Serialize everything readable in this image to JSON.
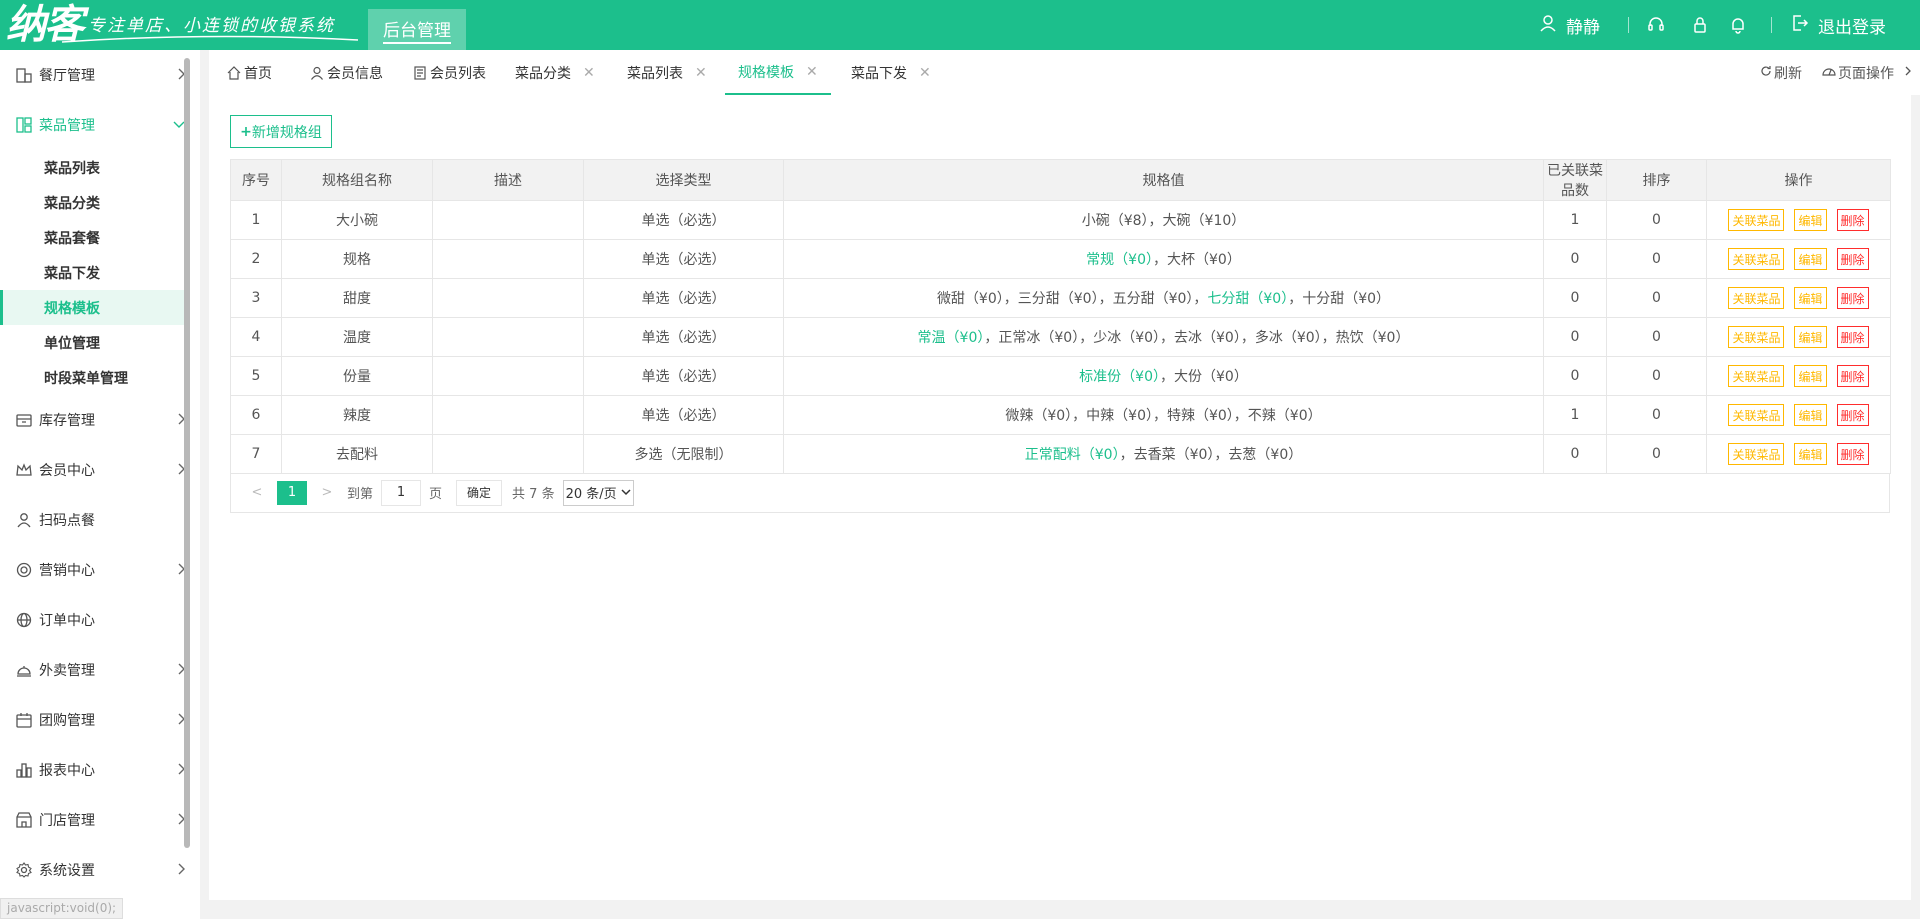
{
  "header": {
    "logo": "纳客",
    "slogan": "专注单店、小连锁的收银系统",
    "admin_tab": "后台管理",
    "user_name": "静静",
    "logout": "退出登录"
  },
  "sidebar": {
    "groups": [
      {
        "label": "餐厅管理",
        "icon": "building-icon"
      },
      {
        "label": "菜品管理",
        "icon": "dashboard-icon"
      },
      {
        "label": "库存管理",
        "icon": "inventory-icon"
      },
      {
        "label": "会员中心",
        "icon": "crown-icon"
      },
      {
        "label": "扫码点餐",
        "icon": "user-icon"
      },
      {
        "label": "营销中心",
        "icon": "target-icon"
      },
      {
        "label": "订单中心",
        "icon": "globe-icon"
      },
      {
        "label": "外卖管理",
        "icon": "bell-tray-icon"
      },
      {
        "label": "团购管理",
        "icon": "calendar-icon"
      },
      {
        "label": "报表中心",
        "icon": "bar-chart-icon"
      },
      {
        "label": "门店管理",
        "icon": "store-icon"
      },
      {
        "label": "系统设置",
        "icon": "gear-icon"
      }
    ],
    "sub_items": [
      "菜品列表",
      "菜品分类",
      "菜品套餐",
      "菜品下发",
      "规格模板",
      "单位管理",
      "时段菜单管理"
    ],
    "status_url": "javascript:void(0);"
  },
  "tabs": [
    {
      "label": "首页",
      "icon": "home-icon"
    },
    {
      "label": "会员信息",
      "icon": "user-icon"
    },
    {
      "label": "会员列表",
      "icon": "list-icon"
    },
    {
      "label": "菜品分类"
    },
    {
      "label": "菜品列表"
    },
    {
      "label": "规格模板"
    },
    {
      "label": "菜品下发"
    }
  ],
  "tab_tools": {
    "refresh": "刷新",
    "page_ops": "页面操作"
  },
  "toolbar": {
    "add_label": "新增规格组"
  },
  "table": {
    "headers": [
      "序号",
      "规格组名称",
      "描述",
      "选择类型",
      "规格值",
      "已关联菜品数",
      "排序",
      "操作"
    ],
    "rows": [
      {
        "no": "1",
        "name": "大小碗",
        "desc": "",
        "type": "单选（必选）",
        "spec_default": "",
        "spec_rest": "小碗（¥8），大碗（¥10）",
        "spec_prefix": "",
        "linked": "1",
        "sort": "0"
      },
      {
        "no": "2",
        "name": "规格",
        "desc": "",
        "type": "单选（必选）",
        "spec_prefix": "",
        "spec_default": "常规（¥0）",
        "spec_rest": "，大杯（¥0）",
        "linked": "0",
        "sort": "0"
      },
      {
        "no": "3",
        "name": "甜度",
        "desc": "",
        "type": "单选（必选）",
        "spec_prefix": "微甜（¥0），三分甜（¥0），五分甜（¥0），",
        "spec_default": "七分甜（¥0）",
        "spec_rest": "，十分甜（¥0）",
        "linked": "0",
        "sort": "0"
      },
      {
        "no": "4",
        "name": "温度",
        "desc": "",
        "type": "单选（必选）",
        "spec_prefix": "",
        "spec_default": "常温（¥0）",
        "spec_rest": "，正常冰（¥0），少冰（¥0），去冰（¥0），多冰（¥0），热饮（¥0）",
        "linked": "0",
        "sort": "0"
      },
      {
        "no": "5",
        "name": "份量",
        "desc": "",
        "type": "单选（必选）",
        "spec_prefix": "",
        "spec_default": "标准份（¥0）",
        "spec_rest": "，大份（¥0）",
        "linked": "0",
        "sort": "0"
      },
      {
        "no": "6",
        "name": "辣度",
        "desc": "",
        "type": "单选（必选）",
        "spec_prefix": "",
        "spec_default": "",
        "spec_rest": "微辣（¥0），中辣（¥0），特辣（¥0），不辣（¥0）",
        "linked": "1",
        "sort": "0"
      },
      {
        "no": "7",
        "name": "去配料",
        "desc": "",
        "type": "多选（无限制）",
        "spec_prefix": "",
        "spec_default": "正常配料（¥0）",
        "spec_rest": "，去香菜（¥0），去葱（¥0）",
        "linked": "0",
        "sort": "0"
      }
    ],
    "actions": {
      "link": "关联菜品",
      "edit": "编辑",
      "delete": "删除"
    }
  },
  "pagination": {
    "current": "1",
    "goto_label": "到第",
    "page_input": "1",
    "page_unit": "页",
    "confirm": "确定",
    "total": "共 7 条",
    "page_size": "20 条/页"
  },
  "colors": {
    "brand": "#1cbf8c",
    "warn": "#ffb800",
    "danger": "#ff2d2d"
  }
}
